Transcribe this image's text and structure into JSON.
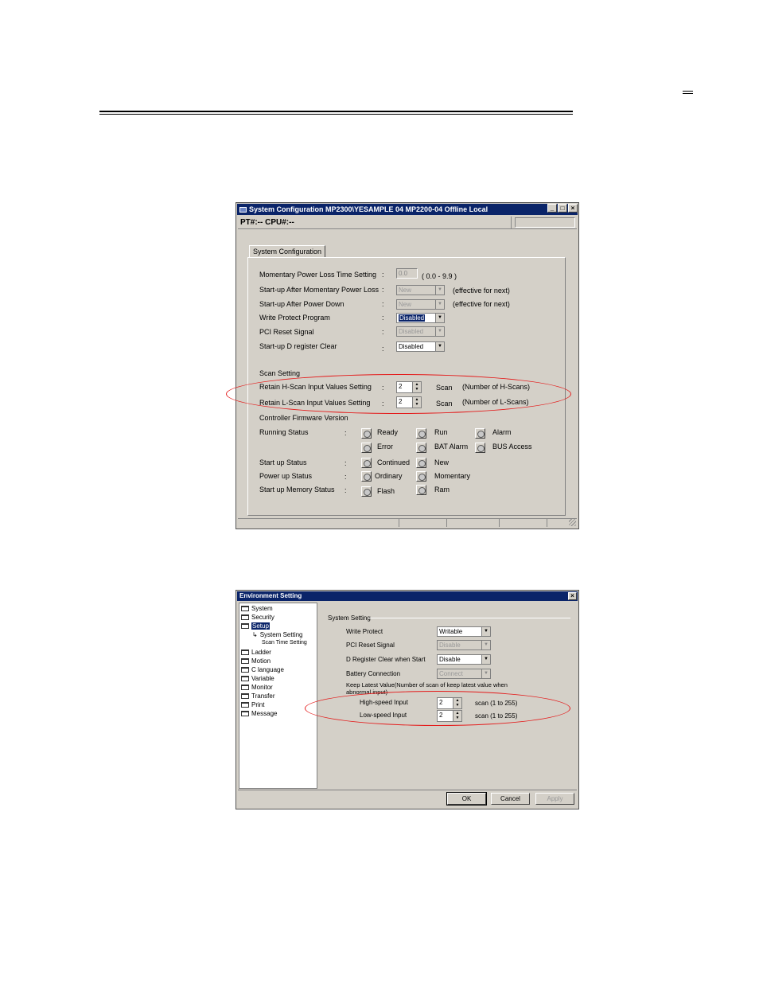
{
  "window1": {
    "title": "System Configuration   MP2300\\YESAMPLE 04  MP2200-04   Offline  Local",
    "status_line": "PT#:-- CPU#:--",
    "tab": "System Configuration",
    "rows": [
      {
        "label": "Momentary Power Loss Time Setting",
        "value": "0.0",
        "note": "( 0.0 - 9.9 )"
      },
      {
        "label": "Start-up After Momentary Power Loss",
        "value": "New",
        "note": "(effective for next)"
      },
      {
        "label": "Start-up After Power Down",
        "value": "New",
        "note": "(effective for next)"
      },
      {
        "label": "Write Protect Program",
        "value": "Disabled"
      },
      {
        "label": "PCI Reset Signal",
        "value": "Disabled"
      },
      {
        "label": "Start-up D register Clear",
        "value": "Disabled"
      }
    ],
    "scan_setting": {
      "heading": "Scan Setting",
      "h_label": "Retain H-Scan Input Values Setting",
      "h_value": "2",
      "h_unit": "Scan",
      "h_note": "(Number of H-Scans)",
      "l_label": "Retain L-Scan Input Values Setting",
      "l_value": "2",
      "l_unit": "Scan",
      "l_note": "(Number of L-Scans)"
    },
    "firmware_label": "Controller Firmware Version",
    "colon": ":",
    "running_status": {
      "label": "Running Status",
      "items": [
        "Ready",
        "Run",
        "Alarm",
        "Error",
        "BAT Alarm",
        "BUS Access"
      ]
    },
    "startup_status": {
      "label": "Start up Status",
      "items": [
        "Continued",
        "New"
      ]
    },
    "powerup_status": {
      "label": "Power up Status",
      "items": [
        "Ordinary",
        "Momentary"
      ]
    },
    "memory_status": {
      "label": "Start up Memory Status",
      "items": [
        "Flash",
        "Ram"
      ]
    }
  },
  "window2": {
    "title": "Environment Setting",
    "tree": [
      {
        "label": "System"
      },
      {
        "label": "Security"
      },
      {
        "label": "Setup"
      },
      {
        "label": "System Setting"
      },
      {
        "label": "Scan Time Setting"
      },
      {
        "label": "Ladder"
      },
      {
        "label": "Motion"
      },
      {
        "label": "C language"
      },
      {
        "label": "Variable"
      },
      {
        "label": "Monitor"
      },
      {
        "label": "Transfer"
      },
      {
        "label": "Print"
      },
      {
        "label": "Message"
      }
    ],
    "group_title": "System Setting",
    "write_protect": {
      "label": "Write Protect",
      "value": "Writable"
    },
    "pci_reset": {
      "label": "PCI Reset Signal",
      "value": "Disable"
    },
    "d_register": {
      "label": "D Register Clear when Start",
      "value": "Disable"
    },
    "battery": {
      "label": "Battery Connection",
      "value": "Connect"
    },
    "keep_latest": "Keep Latest Value(Number of scan of keep latest value when abnormal input)",
    "high_speed": {
      "label": "High-speed Input",
      "value": "2",
      "note": "scan (1 to 255)"
    },
    "low_speed": {
      "label": "Low-speed Input",
      "value": "2",
      "note": "scan (1 to 255)"
    },
    "buttons": {
      "ok": "OK",
      "cancel": "Cancel",
      "apply": "Apply"
    }
  },
  "colors": {
    "titlebar": "#0a2469",
    "window_bg": "#d4d0c8",
    "highlight_ellipse": "#e41b1b"
  }
}
